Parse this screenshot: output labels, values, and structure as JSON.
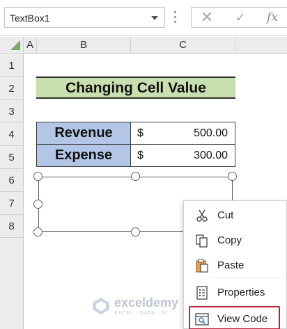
{
  "formula_bar": {
    "name_box_value": "TextBox1",
    "cancel_icon": "x-icon",
    "enter_icon": "check-icon",
    "function_label": "fx"
  },
  "columns": [
    "A",
    "B",
    "C"
  ],
  "rows": [
    "1",
    "2",
    "3",
    "4",
    "5",
    "6",
    "7",
    "8"
  ],
  "sheet": {
    "title": "Changing Cell Value",
    "table": [
      {
        "label": "Revenue",
        "currency": "$",
        "amount": "500.00"
      },
      {
        "label": "Expense",
        "currency": "$",
        "amount": "300.00"
      }
    ]
  },
  "context_menu": {
    "items": [
      {
        "label": "Cut",
        "icon": "scissors-icon"
      },
      {
        "label": "Copy",
        "icon": "copy-icon"
      },
      {
        "label": "Paste",
        "icon": "paste-icon"
      },
      {
        "label": "Properties",
        "icon": "properties-icon"
      },
      {
        "label": "View Code",
        "icon": "view-code-icon"
      }
    ]
  },
  "watermark": {
    "name": "exceldemy",
    "tagline": "EXCEL · DATA · BI"
  },
  "colors": {
    "title_fill": "#c8e0b0",
    "label_fill": "#b4c6e7",
    "highlight_border": "#c0203a"
  }
}
